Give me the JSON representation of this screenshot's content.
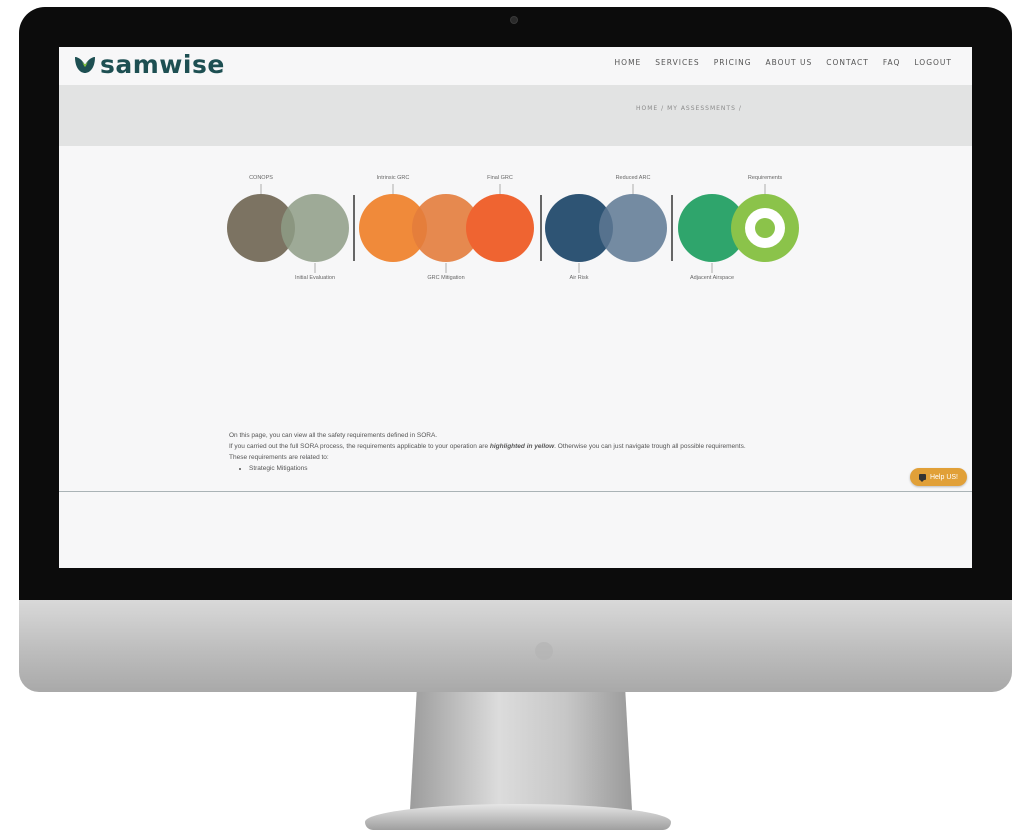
{
  "brand": {
    "name": "samwise",
    "color": "#1d4f52"
  },
  "nav": {
    "items": [
      "HOME",
      "SERVICES",
      "PRICING",
      "ABOUT US",
      "CONTACT",
      "FAQ",
      "LOGOUT"
    ]
  },
  "breadcrumb": {
    "home": "HOME",
    "sep": "/",
    "current": "MY ASSESSMENTS"
  },
  "diagram": {
    "labels": {
      "conops": "CONOPS",
      "initial_evaluation": "Initial Evaluation",
      "intrinsic_grc": "Intrinsic GRC",
      "grc_mitigation": "GRC Mitigation",
      "final_grc": "Final GRC",
      "air_risk": "Air Risk",
      "reduced_arc": "Reduced ARC",
      "adjacent_airspace": "Adjacent Airspace",
      "requirements": "Requirements"
    },
    "colors": {
      "conops": "#7c7362",
      "initial_evaluation": "#8e9c86",
      "intrinsic_grc": "#f08a3a",
      "grc_mitigation": "#e37c3c",
      "final_grc": "#ef6431",
      "air_risk": "#2e5474",
      "reduced_arc": "#5d7893",
      "adjacent_airspace": "#2fa56c",
      "requirements": "#8bc34a"
    }
  },
  "intro": {
    "line1": "On this page, you can view all the safety requirements defined in SORA.",
    "line2_pre": "If you carried out the full SORA process, the requirements applicable to your operation are ",
    "line2_emph": "highlighted in yellow",
    "line2_post": ". Otherwise you can just navigate trough all possible requirements.",
    "line3": "These requirements are related to:",
    "bullets": [
      "Strategic Mitigations"
    ]
  },
  "help": {
    "label": "Help US!",
    "color": "#e1a038"
  }
}
